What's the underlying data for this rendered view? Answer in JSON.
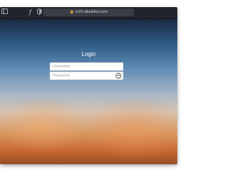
{
  "browser": {
    "url": "rc22.atlasklox.com",
    "icons": {
      "sidebar": "sidebar-icon",
      "text": "text-icon",
      "shield": "shield-icon",
      "lock": "lock-icon"
    }
  },
  "login": {
    "title": "Login",
    "username_placeholder": "Username",
    "password_placeholder": "Password",
    "submit_icon": "arrow-right-circle-icon"
  }
}
